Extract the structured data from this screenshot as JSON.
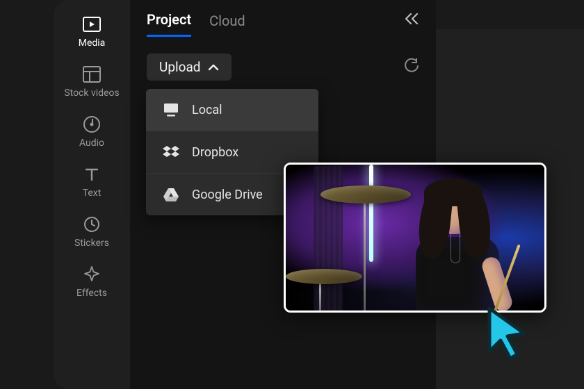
{
  "sidebar": {
    "items": [
      {
        "label": "Media",
        "icon": "play-frame"
      },
      {
        "label": "Stock videos",
        "icon": "layout-panel"
      },
      {
        "label": "Audio",
        "icon": "disc-note"
      },
      {
        "label": "Text",
        "icon": "letter-t"
      },
      {
        "label": "Stickers",
        "icon": "clock"
      },
      {
        "label": "Effects",
        "icon": "sparkle"
      }
    ],
    "active_index": 0
  },
  "tabs": {
    "items": [
      {
        "label": "Project"
      },
      {
        "label": "Cloud"
      }
    ],
    "active_index": 0
  },
  "toolbar": {
    "upload_label": "Upload"
  },
  "upload_menu": {
    "items": [
      {
        "label": "Local",
        "icon": "monitor"
      },
      {
        "label": "Dropbox",
        "icon": "dropbox"
      },
      {
        "label": "Google Drive",
        "icon": "gdrive"
      }
    ],
    "highlighted_index": 0
  },
  "thumbnail": {
    "description": "Long-haired drummer with drumsticks and golden cymbals, lit by purple and blue neon light"
  },
  "colors": {
    "accent": "#0066ff",
    "cursor": "#25c7e8"
  }
}
